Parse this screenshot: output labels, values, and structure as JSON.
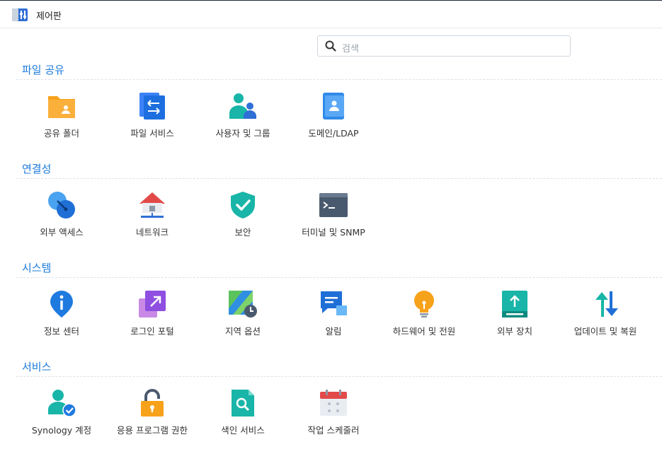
{
  "window": {
    "title": "제어판"
  },
  "search": {
    "placeholder": "검색"
  },
  "sections": [
    {
      "title": "파일 공유",
      "items": [
        {
          "label": "공유 폴더",
          "icon": "shared-folder-icon"
        },
        {
          "label": "파일 서비스",
          "icon": "file-services-icon"
        },
        {
          "label": "사용자 및 그룹",
          "icon": "user-group-icon"
        },
        {
          "label": "도메인/LDAP",
          "icon": "domain-ldap-icon"
        }
      ]
    },
    {
      "title": "연결성",
      "items": [
        {
          "label": "외부 액세스",
          "icon": "external-access-icon"
        },
        {
          "label": "네트워크",
          "icon": "network-icon"
        },
        {
          "label": "보안",
          "icon": "security-shield-icon"
        },
        {
          "label": "터미널 및 SNMP",
          "icon": "terminal-icon"
        }
      ]
    },
    {
      "title": "시스템",
      "items": [
        {
          "label": "정보 센터",
          "icon": "info-center-icon"
        },
        {
          "label": "로그인 포털",
          "icon": "login-portal-icon"
        },
        {
          "label": "지역 옵션",
          "icon": "regional-options-icon"
        },
        {
          "label": "알림",
          "icon": "notification-icon"
        },
        {
          "label": "하드웨어 및 전원",
          "icon": "hardware-power-icon"
        },
        {
          "label": "외부 장치",
          "icon": "external-devices-icon"
        },
        {
          "label": "업데이트 및 복원",
          "icon": "update-restore-icon"
        }
      ]
    },
    {
      "title": "서비스",
      "items": [
        {
          "label": "Synology 계정",
          "icon": "synology-account-icon"
        },
        {
          "label": "응용 프로그램 권한",
          "icon": "application-privileges-icon"
        },
        {
          "label": "색인 서비스",
          "icon": "indexing-service-icon"
        },
        {
          "label": "작업 스케줄러",
          "icon": "task-scheduler-icon"
        }
      ]
    }
  ]
}
